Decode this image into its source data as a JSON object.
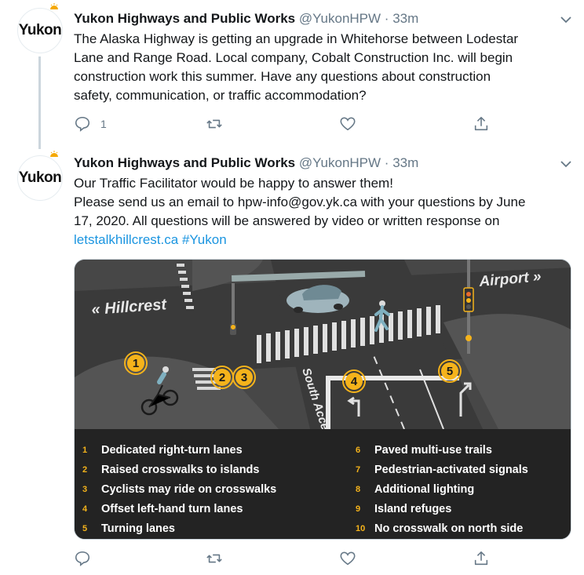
{
  "tweets": [
    {
      "name": "Yukon Highways and Public Works",
      "handle": "@YukonHPW",
      "separator": "·",
      "time": "33m",
      "avatar_text": "Yukon",
      "text_lines": [
        "The Alaska Highway is getting an upgrade in Whitehorse between Lodestar",
        "Lane and Range Road. Local company, Cobalt Construction Inc. will begin",
        "construction work this summer. Have any questions about construction",
        "safety, communication, or traffic accommodation?"
      ],
      "actions": {
        "reply_count": "1",
        "retweet_count": "",
        "like_count": ""
      }
    },
    {
      "name": "Yukon Highways and Public Works",
      "handle": "@YukonHPW",
      "separator": "·",
      "time": "33m",
      "avatar_text": "Yukon",
      "text_lines": [
        "Our Traffic Facilitator would be happy to answer them!",
        "Please send us an email to hpw-info@gov.yk.ca with your questions by June",
        "17, 2020. All questions will be answered by video or written response on"
      ],
      "link_text": "letstalkhillcrest.ca",
      "hashtag": "#Yukon",
      "infographic": {
        "label_hillcrest": "« Hillcrest",
        "label_airport": "Airport »",
        "label_south_access": "South Access »",
        "badges": [
          "1",
          "2",
          "3",
          "4",
          "5"
        ],
        "legend_left": [
          {
            "num": "1",
            "text": "Dedicated right-turn lanes"
          },
          {
            "num": "2",
            "text": "Raised crosswalks to islands"
          },
          {
            "num": "3",
            "text": "Cyclists may ride on crosswalks"
          },
          {
            "num": "4",
            "text": "Offset left-hand turn lanes"
          },
          {
            "num": "5",
            "text": "Turning lanes"
          }
        ],
        "legend_right": [
          {
            "num": "6",
            "text": "Paved multi-use trails"
          },
          {
            "num": "7",
            "text": "Pedestrian-activated signals"
          },
          {
            "num": "8",
            "text": "Additional lighting"
          },
          {
            "num": "9",
            "text": "Island refuges"
          },
          {
            "num": "10",
            "text": "No crosswalk on north side"
          }
        ],
        "accent_color": "#f5b31b"
      },
      "actions": {
        "reply_count": "",
        "retweet_count": "",
        "like_count": ""
      }
    }
  ],
  "icons": {
    "reply": "reply-icon",
    "retweet": "retweet-icon",
    "like": "heart-icon",
    "share": "share-icon",
    "caret": "chevron-down-icon"
  },
  "colors": {
    "link": "#1b95e0",
    "muted": "#657786",
    "thread_line": "#ccd6dd"
  }
}
